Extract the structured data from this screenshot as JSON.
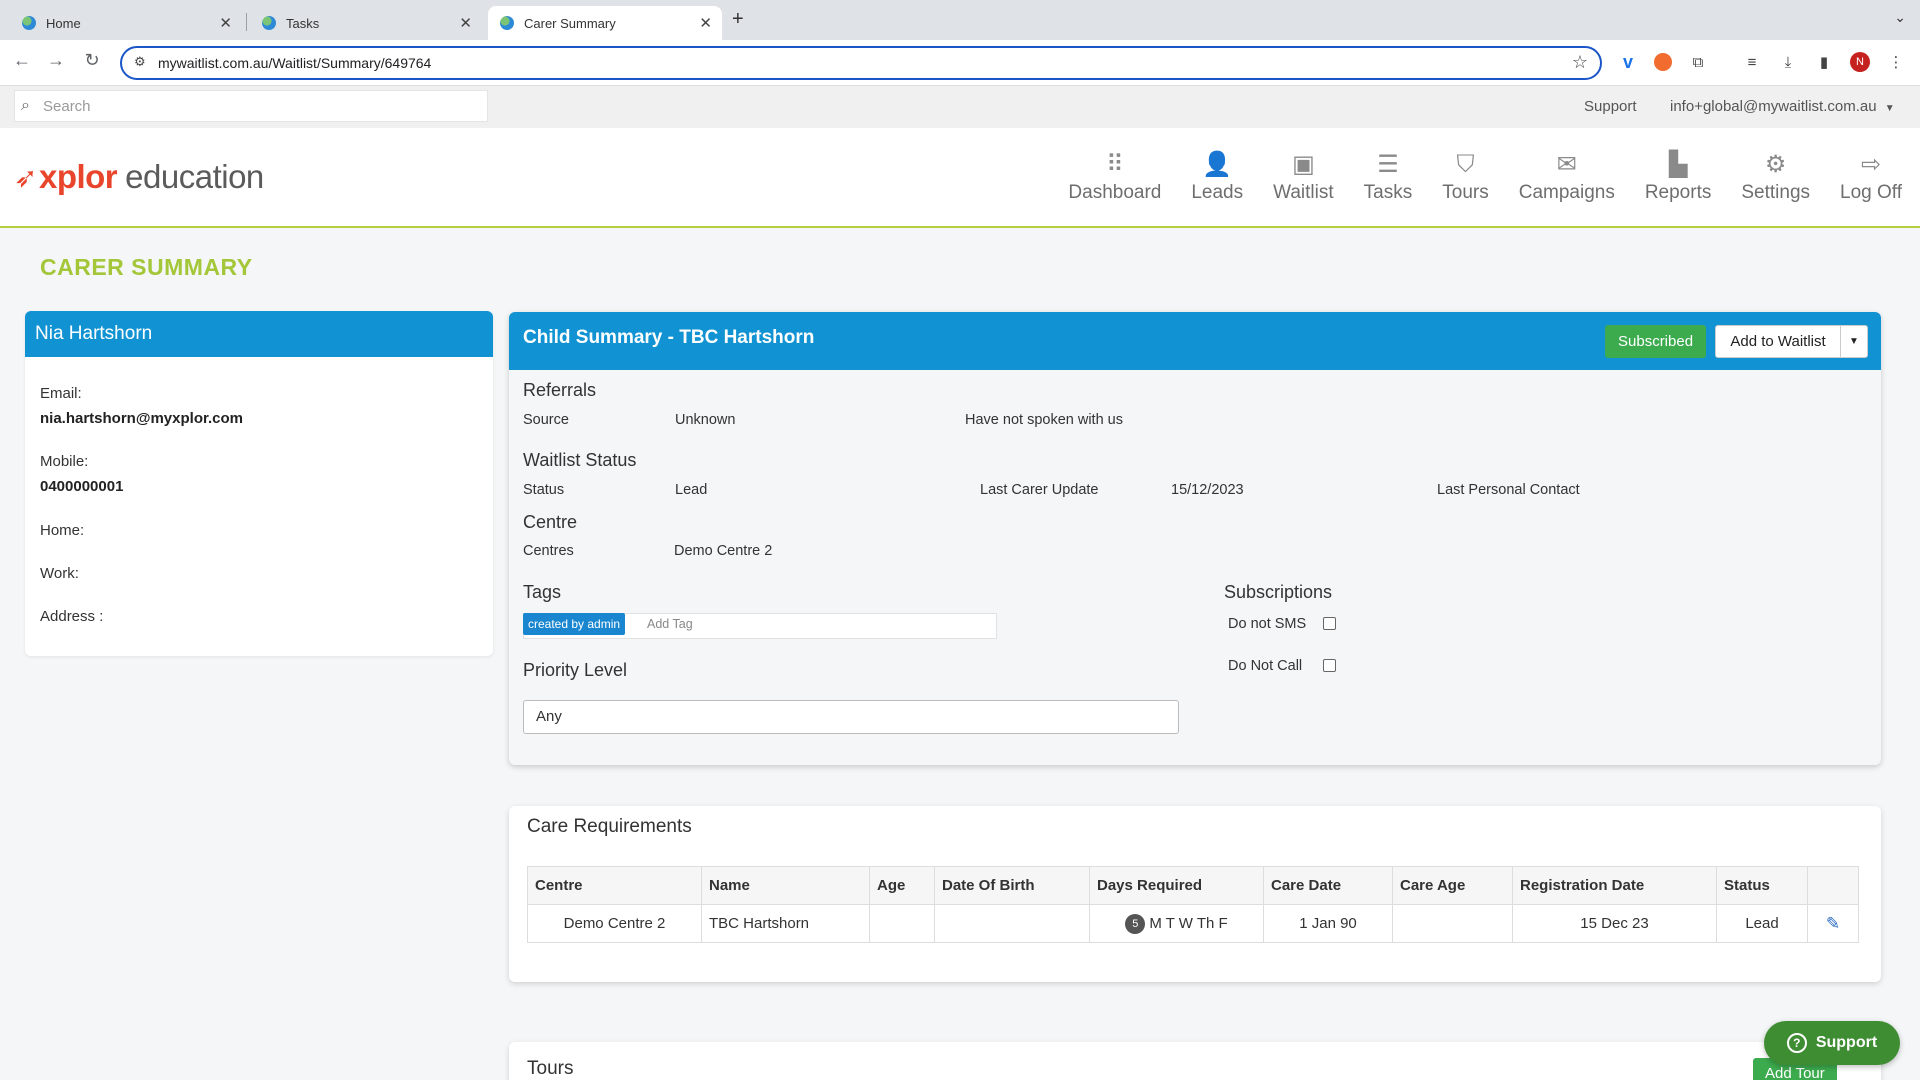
{
  "browser": {
    "tabs": [
      {
        "label": "Home"
      },
      {
        "label": "Tasks"
      },
      {
        "label": "Carer Summary"
      }
    ],
    "url": "mywaitlist.com.au/Waitlist/Summary/649764",
    "avatar_letter": "N"
  },
  "topstrip": {
    "search_placeholder": "Search",
    "support": "Support",
    "user": "info+global@mywaitlist.com.au"
  },
  "header": {
    "brand_part1": "xplor",
    "brand_part2": "education",
    "nav": [
      {
        "label": "Dashboard",
        "icon": "dashboard-icon"
      },
      {
        "label": "Leads",
        "icon": "user-plus-icon"
      },
      {
        "label": "Waitlist",
        "icon": "inbox-icon"
      },
      {
        "label": "Tasks",
        "icon": "list-icon"
      },
      {
        "label": "Tours",
        "icon": "map-icon"
      },
      {
        "label": "Campaigns",
        "icon": "envelope-icon"
      },
      {
        "label": "Reports",
        "icon": "bar-chart-icon"
      },
      {
        "label": "Settings",
        "icon": "gear-icon"
      },
      {
        "label": "Log Off",
        "icon": "sign-out-icon"
      }
    ]
  },
  "page": {
    "title": "CARER SUMMARY"
  },
  "carer": {
    "name": "Nia Hartshorn",
    "email_label": "Email:",
    "email": "nia.hartshorn@myxplor.com",
    "mobile_label": "Mobile:",
    "mobile": "0400000001",
    "home_label": "Home:",
    "work_label": "Work:",
    "address_label": "Address :"
  },
  "child": {
    "title": "Child Summary - TBC Hartshorn",
    "subscribed": "Subscribed",
    "add_to_waitlist": "Add to Waitlist",
    "referrals": {
      "heading": "Referrals",
      "source_label": "Source",
      "source_value": "Unknown",
      "note": "Have not spoken with us"
    },
    "waitlist_status": {
      "heading": "Waitlist Status",
      "status_label": "Status",
      "status_value": "Lead",
      "last_carer_update_label": "Last Carer Update",
      "last_carer_update_value": "15/12/2023",
      "last_personal_contact_label": "Last Personal Contact"
    },
    "centre": {
      "heading": "Centre",
      "centres_label": "Centres",
      "centres_value": "Demo Centre 2"
    },
    "tags": {
      "heading": "Tags",
      "tag": "created by admin",
      "add_placeholder": "Add Tag"
    },
    "subscriptions": {
      "heading": "Subscriptions",
      "sms_label": "Do not SMS",
      "call_label": "Do Not Call"
    },
    "priority": {
      "heading": "Priority Level",
      "value": "Any"
    }
  },
  "care_requirements": {
    "title": "Care Requirements",
    "columns": [
      "Centre",
      "Name",
      "Age",
      "Date Of Birth",
      "Days Required",
      "Care Date",
      "Care Age",
      "Registration Date",
      "Status",
      ""
    ],
    "rows": [
      {
        "centre": "Demo Centre 2",
        "name": "TBC Hartshorn",
        "age": "",
        "dob": "",
        "days_count": "5",
        "days": "M T W Th F",
        "care_date": "1 Jan 90",
        "care_age": "",
        "registration_date": "15 Dec 23",
        "status": "Lead"
      }
    ]
  },
  "tours": {
    "title": "Tours",
    "add_tour": "Add Tour"
  },
  "support_float": "Support"
}
